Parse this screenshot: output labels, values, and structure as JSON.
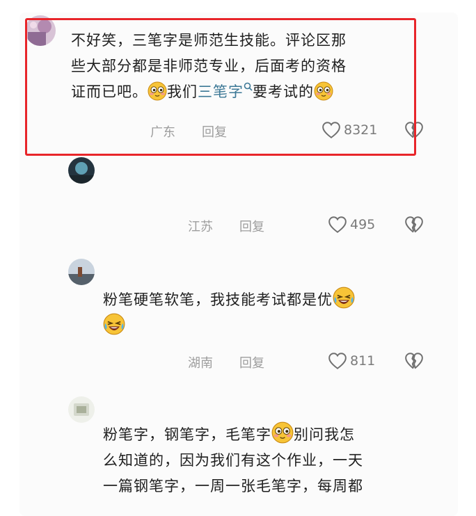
{
  "comments": [
    {
      "lines": [
        "不好笑，三笔字是师范生技能。评论区那",
        "些大部分都是非师范专业，后面考的资格",
        "证而已吧。",
        "我们",
        "三笔字",
        "要考试的"
      ],
      "location": "广东",
      "reply_label": "回复",
      "likes": "8321"
    },
    {
      "lines": [],
      "location": "江苏",
      "reply_label": "回复",
      "likes": "495"
    },
    {
      "lines": [
        "粉笔硬笔软笔，我技能考试都是优"
      ],
      "location": "湖南",
      "reply_label": "回复",
      "likes": "811"
    },
    {
      "lines": [
        "粉笔字，钢笔字，毛笔字",
        "别问我怎",
        "么知道的，因为我们有这个作业，一天",
        "一篇钢笔字，一周一张毛笔字，每周都"
      ]
    }
  ],
  "icons": {
    "like": "heart-outline-icon",
    "dislike": "broken-heart-icon",
    "keyword_search": "search-icon",
    "emoji_1": "smiling-blush-emoji",
    "emoji_2": "rolling-laughing-emoji"
  },
  "colors": {
    "highlight_box": "#e8252a",
    "keyword_link": "#3c7896",
    "meta_text": "#9d9d9d"
  }
}
